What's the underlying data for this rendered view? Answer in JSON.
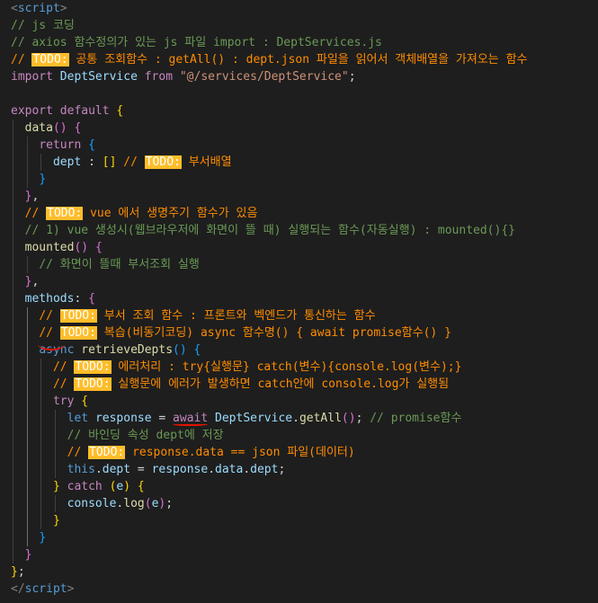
{
  "editor": {
    "lines": [
      {
        "indent": 0,
        "tokens": [
          {
            "c": "t-tag",
            "t": "<"
          },
          {
            "c": "t-tagname",
            "t": "script"
          },
          {
            "c": "t-tag",
            "t": ">"
          }
        ]
      },
      {
        "indent": 0,
        "tokens": [
          {
            "c": "t-cmt",
            "t": "// js 코딩"
          }
        ]
      },
      {
        "indent": 0,
        "tokens": [
          {
            "c": "t-cmt",
            "t": "// axios 함수정의가 있는 js 파일 import : DeptServices.js"
          }
        ]
      },
      {
        "indent": 0,
        "tokens": [
          {
            "c": "t-cmt-todo",
            "t": "// "
          },
          {
            "c": "todo-badge",
            "t": "TODO:"
          },
          {
            "c": "t-cmt-todo",
            "t": " 공통 조회함수 : getAll() : dept.json 파일을 읽어서 객체배열을 가져오는 함수"
          }
        ]
      },
      {
        "indent": 0,
        "tokens": [
          {
            "c": "t-ctl",
            "t": "import"
          },
          {
            "c": "t-punc",
            "t": " "
          },
          {
            "c": "t-var",
            "t": "DeptService"
          },
          {
            "c": "t-punc",
            "t": " "
          },
          {
            "c": "t-ctl",
            "t": "from"
          },
          {
            "c": "t-punc",
            "t": " "
          },
          {
            "c": "t-str",
            "t": "\"@/services/DeptService\""
          },
          {
            "c": "t-punc",
            "t": ";"
          }
        ]
      },
      {
        "indent": 0,
        "tokens": []
      },
      {
        "indent": 0,
        "tokens": [
          {
            "c": "t-ctl",
            "t": "export"
          },
          {
            "c": "t-punc",
            "t": " "
          },
          {
            "c": "t-ctl",
            "t": "default"
          },
          {
            "c": "t-punc",
            "t": " "
          },
          {
            "c": "t-br1",
            "t": "{"
          }
        ]
      },
      {
        "indent": 1,
        "tokens": [
          {
            "c": "t-func",
            "t": "data"
          },
          {
            "c": "t-br2",
            "t": "()"
          },
          {
            "c": "t-punc",
            "t": " "
          },
          {
            "c": "t-br2",
            "t": "{"
          }
        ]
      },
      {
        "indent": 2,
        "tokens": [
          {
            "c": "t-ctl",
            "t": "return"
          },
          {
            "c": "t-punc",
            "t": " "
          },
          {
            "c": "t-br3",
            "t": "{"
          }
        ]
      },
      {
        "indent": 3,
        "tokens": [
          {
            "c": "t-var",
            "t": "dept"
          },
          {
            "c": "t-punc",
            "t": " : "
          },
          {
            "c": "t-br1",
            "t": "[]"
          },
          {
            "c": "t-punc",
            "t": " "
          },
          {
            "c": "t-cmt-todo",
            "t": "// "
          },
          {
            "c": "todo-badge",
            "t": "TODO:"
          },
          {
            "c": "t-cmt-todo",
            "t": " 부서배열"
          }
        ]
      },
      {
        "indent": 2,
        "tokens": [
          {
            "c": "t-br3",
            "t": "}"
          }
        ]
      },
      {
        "indent": 1,
        "tokens": [
          {
            "c": "t-br2",
            "t": "}"
          },
          {
            "c": "t-punc",
            "t": ","
          }
        ]
      },
      {
        "indent": 1,
        "tokens": [
          {
            "c": "t-cmt-todo",
            "t": "// "
          },
          {
            "c": "todo-badge",
            "t": "TODO:"
          },
          {
            "c": "t-cmt-todo",
            "t": " vue 에서 생명주기 함수가 있음"
          }
        ]
      },
      {
        "indent": 1,
        "tokens": [
          {
            "c": "t-cmt",
            "t": "// 1) vue 생성시(웹브라우저에 화면이 뜰 때) 실행되는 함수(자동실행) : mounted(){}"
          }
        ]
      },
      {
        "indent": 1,
        "tokens": [
          {
            "c": "t-func",
            "t": "mounted"
          },
          {
            "c": "t-br2",
            "t": "()"
          },
          {
            "c": "t-punc",
            "t": " "
          },
          {
            "c": "t-br2",
            "t": "{"
          }
        ]
      },
      {
        "indent": 2,
        "tokens": [
          {
            "c": "t-cmt",
            "t": "// 화면이 뜰때 부서조회 실행"
          }
        ]
      },
      {
        "indent": 1,
        "tokens": [
          {
            "c": "t-br2",
            "t": "}"
          },
          {
            "c": "t-punc",
            "t": ","
          }
        ]
      },
      {
        "indent": 1,
        "tokens": [
          {
            "c": "t-var",
            "t": "methods"
          },
          {
            "c": "t-punc",
            "t": ": "
          },
          {
            "c": "t-br2",
            "t": "{"
          }
        ]
      },
      {
        "indent": 2,
        "tokens": [
          {
            "c": "t-cmt-todo",
            "t": "// "
          },
          {
            "c": "todo-badge",
            "t": "TODO:"
          },
          {
            "c": "t-cmt-todo",
            "t": " 부서 조회 함수 : 프론트와 벡엔드가 통신하는 함수"
          }
        ]
      },
      {
        "indent": 2,
        "tokens": [
          {
            "c": "t-cmt-todo",
            "t": "// "
          },
          {
            "c": "todo-badge",
            "t": "TODO:"
          },
          {
            "c": "t-cmt-todo",
            "t": " 복습(비동기코딩) async 함수명() { await promise함수() }"
          }
        ]
      },
      {
        "indent": 2,
        "tokens": [
          {
            "c": "t-kw",
            "t": "async"
          },
          {
            "c": "t-punc",
            "t": " "
          },
          {
            "c": "t-func",
            "t": "retrieveDepts"
          },
          {
            "c": "t-br3",
            "t": "()"
          },
          {
            "c": "t-punc",
            "t": " "
          },
          {
            "c": "t-br3",
            "t": "{"
          }
        ]
      },
      {
        "indent": 3,
        "tokens": [
          {
            "c": "t-cmt-todo",
            "t": "// "
          },
          {
            "c": "todo-badge",
            "t": "TODO:"
          },
          {
            "c": "t-cmt-todo",
            "t": " 에러처리 : try{실행문} catch(변수){console.log(변수);}"
          }
        ]
      },
      {
        "indent": 3,
        "tokens": [
          {
            "c": "t-cmt-todo",
            "t": "// "
          },
          {
            "c": "todo-badge",
            "t": "TODO:"
          },
          {
            "c": "t-cmt-todo",
            "t": " 실행문에 에러가 발생하면 catch안에 console.log가 실행됨"
          }
        ]
      },
      {
        "indent": 3,
        "tokens": [
          {
            "c": "t-ctl",
            "t": "try"
          },
          {
            "c": "t-punc",
            "t": " "
          },
          {
            "c": "t-br1",
            "t": "{"
          }
        ]
      },
      {
        "indent": 4,
        "tokens": [
          {
            "c": "t-kw",
            "t": "let"
          },
          {
            "c": "t-punc",
            "t": " "
          },
          {
            "c": "t-var",
            "t": "response"
          },
          {
            "c": "t-punc",
            "t": " = "
          },
          {
            "c": "t-ctl squiggle-under",
            "t": "await"
          },
          {
            "c": "t-punc",
            "t": " "
          },
          {
            "c": "t-var",
            "t": "DeptService"
          },
          {
            "c": "t-punc",
            "t": "."
          },
          {
            "c": "t-func",
            "t": "getAll"
          },
          {
            "c": "t-br2",
            "t": "()"
          },
          {
            "c": "t-punc",
            "t": "; "
          },
          {
            "c": "t-cmt",
            "t": "// promise함수"
          }
        ]
      },
      {
        "indent": 4,
        "tokens": [
          {
            "c": "t-cmt",
            "t": "// 바인딩 속성 dept에 저장"
          }
        ]
      },
      {
        "indent": 4,
        "tokens": [
          {
            "c": "t-cmt-todo",
            "t": "// "
          },
          {
            "c": "todo-badge",
            "t": "TODO:"
          },
          {
            "c": "t-cmt-todo",
            "t": " response.data == json 파일(데이터)"
          }
        ]
      },
      {
        "indent": 4,
        "tokens": [
          {
            "c": "t-kw",
            "t": "this"
          },
          {
            "c": "t-punc",
            "t": "."
          },
          {
            "c": "t-var",
            "t": "dept"
          },
          {
            "c": "t-punc",
            "t": " = "
          },
          {
            "c": "t-var",
            "t": "response"
          },
          {
            "c": "t-punc",
            "t": "."
          },
          {
            "c": "t-var",
            "t": "data"
          },
          {
            "c": "t-punc",
            "t": "."
          },
          {
            "c": "t-var",
            "t": "dept"
          },
          {
            "c": "t-punc",
            "t": ";"
          }
        ]
      },
      {
        "indent": 3,
        "tokens": [
          {
            "c": "t-br1",
            "t": "}"
          },
          {
            "c": "t-punc",
            "t": " "
          },
          {
            "c": "t-ctl",
            "t": "catch"
          },
          {
            "c": "t-punc",
            "t": " "
          },
          {
            "c": "t-br1",
            "t": "("
          },
          {
            "c": "t-var",
            "t": "e"
          },
          {
            "c": "t-br1",
            "t": ")"
          },
          {
            "c": "t-punc",
            "t": " "
          },
          {
            "c": "t-br1",
            "t": "{"
          }
        ]
      },
      {
        "indent": 4,
        "tokens": [
          {
            "c": "t-var",
            "t": "console"
          },
          {
            "c": "t-punc",
            "t": "."
          },
          {
            "c": "t-func",
            "t": "log"
          },
          {
            "c": "t-br2",
            "t": "("
          },
          {
            "c": "t-var",
            "t": "e"
          },
          {
            "c": "t-br2",
            "t": ")"
          },
          {
            "c": "t-punc",
            "t": ";"
          }
        ]
      },
      {
        "indent": 3,
        "tokens": [
          {
            "c": "t-br1",
            "t": "}"
          }
        ]
      },
      {
        "indent": 2,
        "tokens": [
          {
            "c": "t-br3",
            "t": "}"
          }
        ]
      },
      {
        "indent": 1,
        "tokens": [
          {
            "c": "t-br2",
            "t": "}"
          }
        ]
      },
      {
        "indent": 0,
        "tokens": [
          {
            "c": "t-br1",
            "t": "}"
          },
          {
            "c": "t-punc",
            "t": ";"
          }
        ]
      },
      {
        "indent": 0,
        "tokens": [
          {
            "c": "t-tag",
            "t": "</"
          },
          {
            "c": "t-tagname",
            "t": "script"
          },
          {
            "c": "t-tag",
            "t": ">"
          }
        ]
      }
    ]
  },
  "colors": {
    "background": "#1e1e1e",
    "comment": "#6a9955",
    "todo_comment": "#ff8c00",
    "todo_badge": "#ffbd2a",
    "annotation_red": "#e51400"
  }
}
